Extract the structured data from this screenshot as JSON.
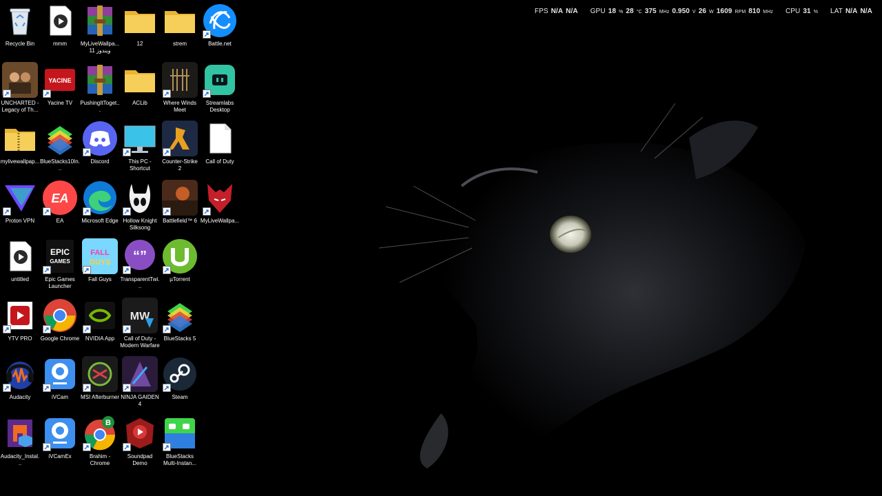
{
  "overlay": {
    "fps": {
      "label": "FPS",
      "v1": "N/A",
      "v2": "N/A"
    },
    "gpu": {
      "label": "GPU",
      "usage": "18",
      "usage_unit": "%",
      "temp": "28",
      "temp_unit": "°C",
      "clock": "375",
      "clock_unit": "MHz",
      "voltage": "0.950",
      "voltage_unit": "V",
      "power": "26",
      "power_unit": "W",
      "fan": "1609",
      "fan_unit": "RPM",
      "mem": "810",
      "mem_unit": "MHz"
    },
    "cpu": {
      "label": "CPU",
      "usage": "31",
      "usage_unit": "%"
    },
    "lat": {
      "label": "LAT",
      "v1": "N/A",
      "v2": "N/A"
    }
  },
  "icons": [
    {
      "label": "Recycle Bin",
      "icon": "recycle-bin-icon",
      "shortcut": false
    },
    {
      "label": "mmm",
      "icon": "video-file-icon",
      "shortcut": false
    },
    {
      "label": "MyLiveWallpa... ويندوز 11",
      "icon": "winrar-archive-icon",
      "shortcut": false
    },
    {
      "label": "12",
      "icon": "folder-icon",
      "shortcut": false
    },
    {
      "label": "strem",
      "icon": "folder-icon",
      "shortcut": false
    },
    {
      "label": "Battle.net",
      "icon": "battlenet-icon",
      "shortcut": true
    },
    {
      "label": "UNCHARTED - Legacy of Th...",
      "icon": "uncharted-game-icon",
      "shortcut": true
    },
    {
      "label": "Yacine TV",
      "icon": "yacine-tv-icon",
      "shortcut": true
    },
    {
      "label": "PushingItToget...",
      "icon": "winrar-archive-icon",
      "shortcut": false
    },
    {
      "label": "ACLib",
      "icon": "folder-icon",
      "shortcut": false
    },
    {
      "label": "Where Winds Meet",
      "icon": "where-winds-meet-icon",
      "shortcut": true
    },
    {
      "label": "Streamlabs Desktop",
      "icon": "streamlabs-icon",
      "shortcut": true
    },
    {
      "label": "mylivewallpap...",
      "icon": "zip-folder-icon",
      "shortcut": false
    },
    {
      "label": "BlueStacks10In...",
      "icon": "bluestacks-icon",
      "shortcut": false
    },
    {
      "label": "Discord",
      "icon": "discord-icon",
      "shortcut": true
    },
    {
      "label": "This PC - Shortcut",
      "icon": "monitor-icon",
      "shortcut": true
    },
    {
      "label": "Counter-Strike 2",
      "icon": "counter-strike-icon",
      "shortcut": true
    },
    {
      "label": "Call of Duty",
      "icon": "blank-file-icon",
      "shortcut": false
    },
    {
      "label": "Proton VPN",
      "icon": "proton-vpn-icon",
      "shortcut": true
    },
    {
      "label": "EA",
      "icon": "ea-icon",
      "shortcut": true
    },
    {
      "label": "Microsoft Edge",
      "icon": "edge-icon",
      "shortcut": true
    },
    {
      "label": "Hollow Knight Silksong",
      "icon": "hollow-knight-icon",
      "shortcut": true
    },
    {
      "label": "Battlefield™ 6",
      "icon": "battlefield-icon",
      "shortcut": true
    },
    {
      "label": "MyLiveWallpa...",
      "icon": "wolf-icon",
      "shortcut": true
    },
    {
      "label": "untitled",
      "icon": "video-file-icon",
      "shortcut": false
    },
    {
      "label": "Epic Games Launcher",
      "icon": "epic-games-icon",
      "shortcut": true
    },
    {
      "label": "Fall Guys",
      "icon": "fall-guys-icon",
      "shortcut": true
    },
    {
      "label": "TransparentTwi...",
      "icon": "transparent-twitch-icon",
      "shortcut": true
    },
    {
      "label": "µTorrent",
      "icon": "utorrent-icon",
      "shortcut": true
    },
    {
      "label": "YTV PRO",
      "icon": "ytv-pro-icon",
      "shortcut": true
    },
    {
      "label": "Google Chrome",
      "icon": "chrome-icon",
      "shortcut": true
    },
    {
      "label": "NVIDIA App",
      "icon": "nvidia-icon",
      "shortcut": true
    },
    {
      "label": "Call of Duty - Modern Warfare",
      "icon": "mw-icon",
      "shortcut": true
    },
    {
      "label": "BlueStacks 5",
      "icon": "bluestacks-icon",
      "shortcut": true
    },
    {
      "label": "Audacity",
      "icon": "audacity-icon",
      "shortcut": true
    },
    {
      "label": "iVCam",
      "icon": "ivcam-icon",
      "shortcut": true
    },
    {
      "label": "MSI Afterburner",
      "icon": "msi-afterburner-icon",
      "shortcut": true
    },
    {
      "label": "NINJA GAIDEN 4",
      "icon": "ninja-gaiden-icon",
      "shortcut": true
    },
    {
      "label": "Steam",
      "icon": "steam-icon",
      "shortcut": true
    },
    {
      "label": "Audacity_Instal...",
      "icon": "audacity-installer-icon",
      "shortcut": false
    },
    {
      "label": "iVCamEx",
      "icon": "ivcam-icon",
      "shortcut": true
    },
    {
      "label": "Brahim - Chrome",
      "icon": "chrome-profile-icon",
      "shortcut": true
    },
    {
      "label": "Soundpad Demo",
      "icon": "soundpad-icon",
      "shortcut": true
    },
    {
      "label": "BlueStacks Multi-Instan...",
      "icon": "bluestacks-multi-icon",
      "shortcut": true
    }
  ]
}
